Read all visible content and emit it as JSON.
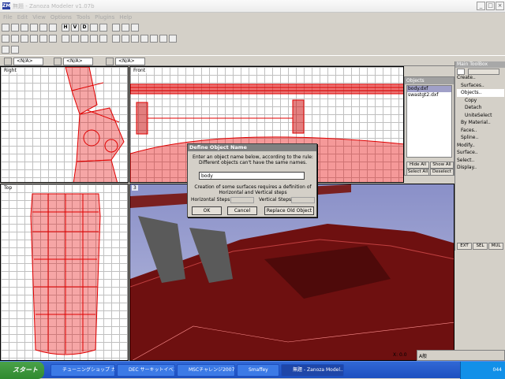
{
  "window": {
    "title": "無題 - Zanoza Modeler v1.07b",
    "icon": "ZM"
  },
  "menu": [
    "File",
    "Edit",
    "View",
    "Options",
    "Tools",
    "Plugins",
    "Help"
  ],
  "toolbar": {
    "row1": [
      "new",
      "open",
      "save",
      "saveas",
      "print",
      "undo",
      "H",
      "V",
      "D",
      "cube",
      "sphere",
      "cylinder",
      "light",
      "record"
    ],
    "row2": [
      "zoom",
      "select",
      "rect",
      "move",
      "rotate",
      "scale",
      "grid",
      "cam",
      "obj1",
      "obj2",
      "obj3",
      "obj4",
      "obj5",
      "tool1",
      "tool2",
      "tool3",
      "tool4",
      "tool5"
    ],
    "row3": [
      "snap",
      "pick"
    ]
  },
  "status_selects": [
    "<N/A>",
    "<N/A>",
    "<N/A>"
  ],
  "viewports": {
    "right": "Right",
    "front": "Front",
    "top": "Top",
    "persp": "3"
  },
  "objects_panel": {
    "title": "Objects",
    "items": [
      "body.dxf",
      "swastgt2.dxf"
    ],
    "hide_all": "Hide All",
    "show_all": "Show All",
    "select_all": "Select All",
    "deselect": "Deselect"
  },
  "toolbox": {
    "title": "Main ToolBox",
    "items": [
      "Create..",
      "Surfaces..",
      "Objects..",
      "Copy",
      "Detach",
      "UniteSelect",
      "By Material..",
      "Faces..",
      "Spline..",
      "Modify..",
      "Surface..",
      "Select..",
      "Display.."
    ],
    "modes": [
      "EXT",
      "SEL",
      "MUL"
    ]
  },
  "dialog": {
    "title": "Define Object Name",
    "line1": "Enter an object name below, according to the rule:",
    "line2": "Different objects can't have the same names.",
    "value": "body",
    "note1": "Creation of some surfaces requires a definition of",
    "note2": "Horizontal and Vertical steps",
    "hsteps": "Horizontal Steps:",
    "vsteps": "Vertical Steps:",
    "ok": "OK",
    "cancel": "Cancel",
    "replace": "Replace Old Object"
  },
  "coord": "X: 0.0",
  "taskbar": {
    "start": "スタート",
    "tasks": [
      "チューニングショップ カ...",
      "DEC サーキットイベント...",
      "MSCチャレンジ2007 第...",
      "Smaffey",
      "無題 - Zanoza Model..."
    ],
    "clock": "044",
    "ime": "A般"
  }
}
